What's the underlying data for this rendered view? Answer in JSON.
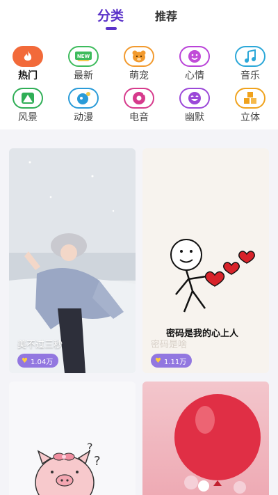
{
  "tabs": {
    "active": "分类",
    "inactive": "推荐"
  },
  "categories": [
    {
      "label": "热门",
      "icon": "flame-icon",
      "color": "#f26a3a",
      "active": true
    },
    {
      "label": "最新",
      "icon": "new-badge-icon",
      "color": "#3dbb5c"
    },
    {
      "label": "萌宠",
      "icon": "bear-icon",
      "color": "#f29a2e"
    },
    {
      "label": "心情",
      "icon": "mood-icon",
      "color": "#b942d8"
    },
    {
      "label": "音乐",
      "icon": "music-note-icon",
      "color": "#2aa7d8"
    },
    {
      "label": "风景",
      "icon": "mountain-icon",
      "color": "#2fae56"
    },
    {
      "label": "动漫",
      "icon": "anime-icon",
      "color": "#2a9bd8"
    },
    {
      "label": "电音",
      "icon": "disc-icon",
      "color": "#d63a8c"
    },
    {
      "label": "幽默",
      "icon": "laugh-icon",
      "color": "#9b48d8"
    },
    {
      "label": "立体",
      "icon": "cubes-icon",
      "color": "#f0a21c"
    }
  ],
  "cards": [
    {
      "title": "美不过三秒",
      "likes": "1.04万"
    },
    {
      "title": "密码是啥",
      "likes": "1.11万",
      "caption": "密码是我的心上人"
    },
    {
      "title": "",
      "likes": ""
    },
    {
      "title": "",
      "likes": ""
    }
  ],
  "colors": {
    "accent": "#5b33c9",
    "badge": "#9277e0",
    "heart": "#ffce3d"
  }
}
